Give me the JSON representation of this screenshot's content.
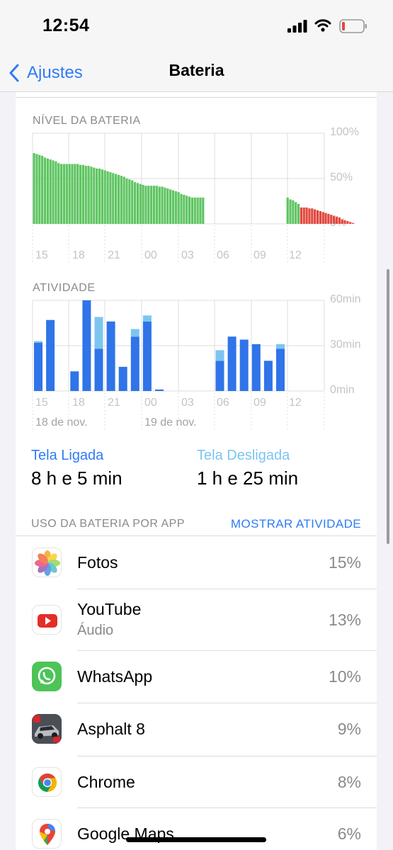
{
  "status": {
    "time": "12:54"
  },
  "nav": {
    "back_label": "Ajustes",
    "title": "Bateria"
  },
  "battery_chart": {
    "label": "NÍVEL DA BATERIA",
    "y_ticks": [
      "100%",
      "50%",
      "0%"
    ],
    "x_ticks": [
      "15",
      "18",
      "21",
      "00",
      "03",
      "06",
      "09",
      "12"
    ],
    "colors": {
      "charged": "#5fc562",
      "low": "#e2483e"
    }
  },
  "activity_chart": {
    "label": "ATIVIDADE",
    "y_ticks": [
      "60min",
      "30min",
      "0min"
    ],
    "x_ticks": [
      "15",
      "18",
      "21",
      "00",
      "03",
      "06",
      "09",
      "12"
    ],
    "dates": [
      "18 de nov.",
      "19 de nov."
    ],
    "colors": {
      "screen_on": "#2f74e8",
      "screen_off": "#7cc5f1"
    }
  },
  "chart_data": [
    {
      "type": "bar",
      "title": "NÍVEL DA BATERIA",
      "ylim": [
        0,
        100
      ],
      "unit": "%",
      "x_ticks": [
        "15",
        "18",
        "21",
        "00",
        "03",
        "06",
        "09",
        "12"
      ],
      "series": [
        {
          "color": "#5fc562",
          "segments": [
            {
              "start": 0,
              "values": [
                78,
                77,
                76,
                75,
                73,
                72,
                71,
                70,
                69,
                67,
                66,
                66,
                66,
                66,
                66,
                66,
                66,
                65,
                65,
                64,
                64,
                63,
                62,
                61,
                61,
                60,
                59,
                58,
                57,
                56,
                55,
                54,
                53,
                52,
                50,
                49,
                48,
                46,
                45,
                44,
                43,
                42,
                42,
                42,
                42,
                42,
                41,
                41,
                40,
                39,
                38,
                37,
                36,
                35,
                33,
                32,
                31,
                30,
                29,
                29,
                29,
                29,
                29
              ]
            },
            {
              "start": 93,
              "values": [
                29,
                27,
                26,
                24,
                22
              ]
            }
          ]
        },
        {
          "color": "#e2483e",
          "segments": [
            {
              "start": 98,
              "values": [
                18,
                18,
                18,
                17,
                17,
                16,
                15,
                14,
                13,
                12,
                11,
                10,
                9,
                8,
                7,
                5,
                4,
                3,
                2,
                1
              ]
            }
          ]
        }
      ]
    },
    {
      "type": "bar",
      "title": "ATIVIDADE",
      "ylim": [
        0,
        60
      ],
      "unit": "min",
      "x_ticks": [
        "15",
        "18",
        "21",
        "00",
        "03",
        "06",
        "09",
        "12"
      ],
      "series": [
        {
          "name": "Tela Ligada",
          "color": "#2f74e8",
          "values": [
            {
              "x": 0,
              "v": 32
            },
            {
              "x": 1,
              "v": 47
            },
            {
              "x": 3,
              "v": 13
            },
            {
              "x": 4,
              "v": 60
            },
            {
              "x": 5,
              "v": 28
            },
            {
              "x": 6,
              "v": 46
            },
            {
              "x": 7,
              "v": 16
            },
            {
              "x": 8,
              "v": 36
            },
            {
              "x": 9,
              "v": 46
            },
            {
              "x": 10,
              "v": 1
            },
            {
              "x": 15,
              "v": 20
            },
            {
              "x": 16,
              "v": 36
            },
            {
              "x": 17,
              "v": 34
            },
            {
              "x": 18,
              "v": 31
            },
            {
              "x": 19,
              "v": 20
            },
            {
              "x": 20,
              "v": 28
            }
          ]
        },
        {
          "name": "Tela Desligada",
          "color": "#7cc5f1",
          "values": [
            {
              "x": 0,
              "v": 1
            },
            {
              "x": 5,
              "v": 21
            },
            {
              "x": 8,
              "v": 5
            },
            {
              "x": 9,
              "v": 4
            },
            {
              "x": 15,
              "v": 7
            },
            {
              "x": 20,
              "v": 3
            }
          ]
        }
      ]
    }
  ],
  "summary": {
    "screen_on_label": "Tela Ligada",
    "screen_on_value": "8 h e 5 min",
    "screen_off_label": "Tela Desligada",
    "screen_off_value": "1 h e 25 min"
  },
  "usage": {
    "header": "USO DA BATERIA POR APP",
    "show_activity": "MOSTRAR ATIVIDADE",
    "apps": [
      {
        "name": "Fotos",
        "sub": "",
        "pct": "15%",
        "icon": "photos-icon"
      },
      {
        "name": "YouTube",
        "sub": "Áudio",
        "pct": "13%",
        "icon": "youtube-icon"
      },
      {
        "name": "WhatsApp",
        "sub": "",
        "pct": "10%",
        "icon": "whatsapp-icon"
      },
      {
        "name": "Asphalt 8",
        "sub": "",
        "pct": "9%",
        "icon": "asphalt-icon"
      },
      {
        "name": "Chrome",
        "sub": "",
        "pct": "8%",
        "icon": "chrome-icon"
      },
      {
        "name": "Google Maps",
        "sub": "",
        "pct": "6%",
        "icon": "maps-icon"
      }
    ]
  }
}
